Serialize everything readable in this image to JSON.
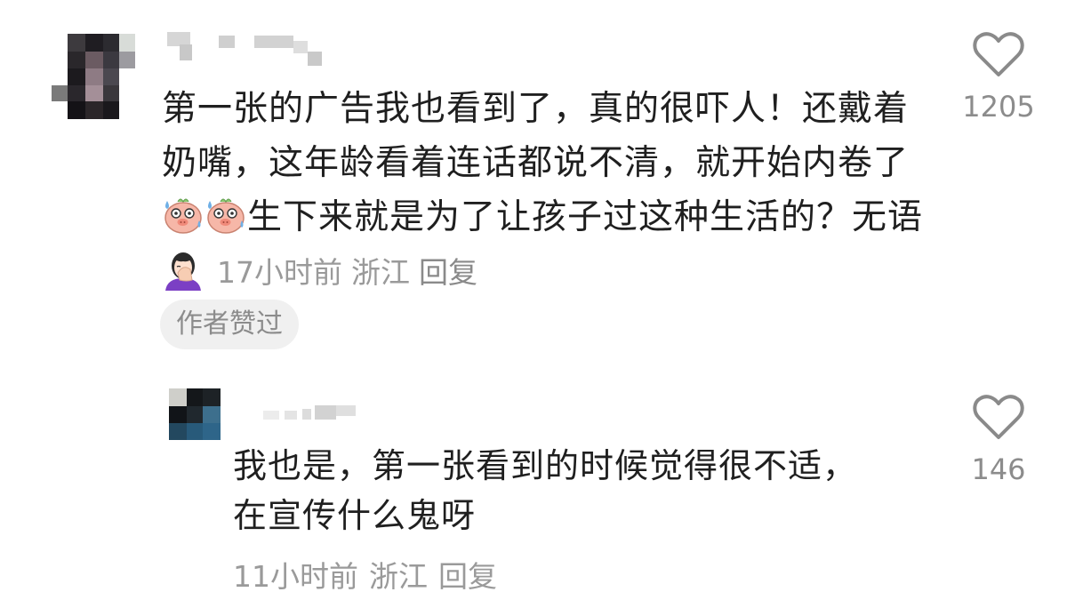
{
  "comment": {
    "text_segments": [
      "第一张的广告我也看到了，真的很吓人！还戴着奶嘴，这年龄看着连话都说不清，就开始内卷了",
      "生下来就是为了让孩子过这种生活的？无语"
    ],
    "emoji": [
      "sweating-piggy-face",
      "sweating-piggy-face",
      "woman-facepalming"
    ],
    "time": "17小时前",
    "location": "浙江",
    "reply_label": "回复",
    "author_badge": "作者赞过",
    "like_count": "1205"
  },
  "reply": {
    "text": "我也是，第一张看到的时候觉得很不适，在宣传什么鬼呀",
    "time": "11小时前",
    "location": "浙江",
    "reply_label": "回复",
    "like_count": "146"
  },
  "colors": {
    "text": "#1f1f1f",
    "meta": "#9a9a9a",
    "badge_bg": "#f0f0f0",
    "heart_outline": "#8a8a8a"
  }
}
